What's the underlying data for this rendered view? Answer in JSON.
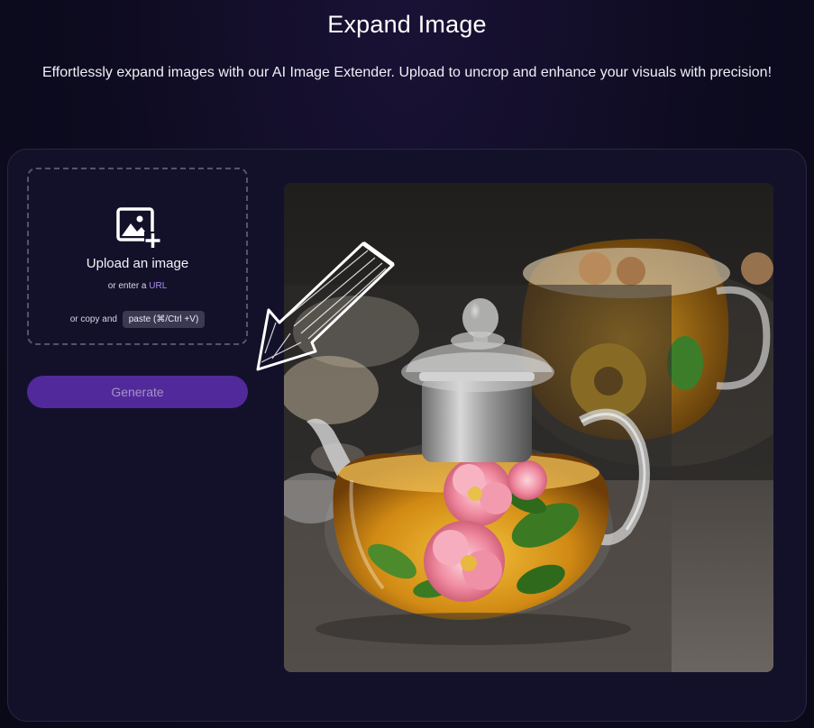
{
  "header": {
    "title": "Expand Image",
    "subtitle": "Effortlessly expand images with our AI Image Extender. Upload to uncrop and enhance your visuals with precision!"
  },
  "upload": {
    "icon": "image-plus-icon",
    "label": "Upload an image",
    "url_prefix": "or enter a",
    "url_link": "URL",
    "paste_prefix": "or copy and",
    "paste_badge": "paste (⌘/Ctrl +V)"
  },
  "actions": {
    "generate_label": "Generate"
  },
  "preview": {
    "subject": "glass-teapot-with-flowers",
    "arrow_icon": "hand-drawn-arrow-icon"
  },
  "colors": {
    "accent": "#52299a",
    "link": "#a98cf0",
    "background": "#0c0a1c",
    "panel": "#13112a"
  }
}
